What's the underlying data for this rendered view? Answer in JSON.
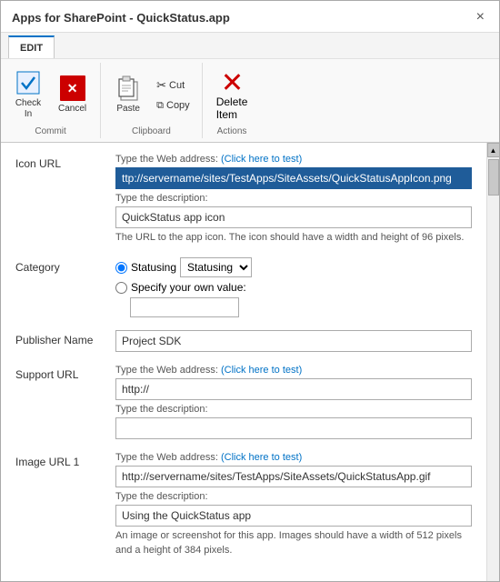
{
  "dialog": {
    "title": "Apps for SharePoint - QuickStatus.app",
    "close_label": "×"
  },
  "ribbon": {
    "tab": "EDIT",
    "groups": [
      {
        "name": "Commit",
        "buttons": [
          {
            "id": "check-in",
            "label": "Check\nIn",
            "icon": "checkin"
          },
          {
            "id": "cancel",
            "label": "Cancel",
            "icon": "cancel"
          }
        ]
      },
      {
        "name": "Clipboard",
        "large_btn": {
          "id": "paste",
          "label": "Paste",
          "icon": "paste"
        },
        "small_btns": [
          {
            "id": "cut",
            "label": "Cut",
            "icon": "scissors"
          },
          {
            "id": "copy",
            "label": "Copy",
            "icon": "copy"
          }
        ]
      },
      {
        "name": "Actions",
        "buttons": [
          {
            "id": "delete-item",
            "label": "Delete\nItem",
            "icon": "delete"
          }
        ]
      }
    ]
  },
  "form": {
    "fields": [
      {
        "id": "icon-url",
        "label": "Icon URL",
        "hint": "Type the Web address: (Click here to test)",
        "hint_link": "Click here to test",
        "value": "ttp://servername/sites/TestApps/SiteAssets/QuickStatusAppIcon.png",
        "value_highlighted": true,
        "description_label": "Type the description:",
        "description_value": "QuickStatus app icon",
        "note": "The URL to the app icon. The icon should have a width and height of 96 pixels."
      },
      {
        "id": "category",
        "label": "Category",
        "type": "radio-select",
        "options": [
          {
            "value": "Statusing",
            "label": "Statusing",
            "selected": true
          },
          {
            "value": "custom",
            "label": "Specify your own value:"
          }
        ],
        "custom_input_value": ""
      },
      {
        "id": "publisher-name",
        "label": "Publisher Name",
        "value": "Project SDK"
      },
      {
        "id": "support-url",
        "label": "Support URL",
        "hint": "Type the Web address: (Click here to test)",
        "hint_link": "Click here to test",
        "value": "http://",
        "description_label": "Type the description:",
        "description_value": ""
      },
      {
        "id": "image-url-1",
        "label": "Image URL 1",
        "hint": "Type the Web address: (Click here to test)",
        "hint_link": "Click here to test",
        "value": "http://servername/sites/TestApps/SiteAssets/QuickStatusApp.gif",
        "description_label": "Type the description:",
        "description_value": "Using the QuickStatus app",
        "note": "An image or screenshot for this app. Images should have a width of 512 pixels and a height of 384 pixels."
      }
    ]
  }
}
